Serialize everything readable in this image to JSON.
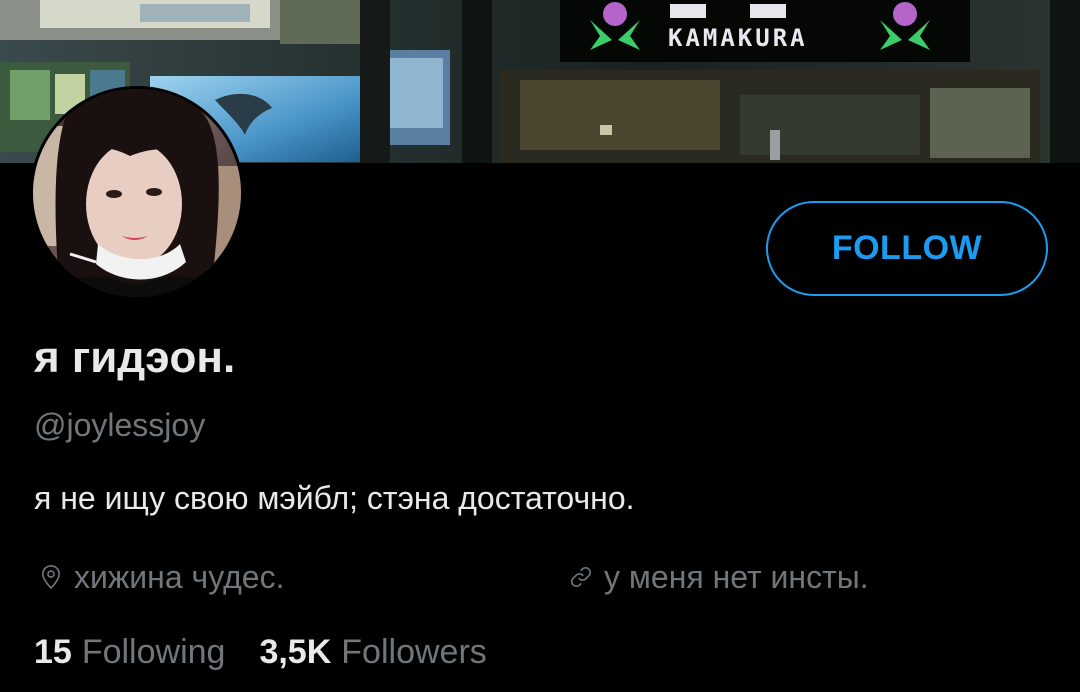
{
  "colors": {
    "background": "#000000",
    "accent": "#1d9bf0",
    "text_primary": "#e7e9ea",
    "text_secondary": "#71767b",
    "sign_green": "#3dcc6a"
  },
  "banner": {
    "sign_text": "KAMAKURA"
  },
  "profile": {
    "follow_label": "FOLLOW",
    "display_name": "я гидэон.",
    "handle": "@joylessjoy",
    "bio": "я не ищу свою мэйбл; стэна достаточно.",
    "location": {
      "icon": "location-pin-icon",
      "text": "хижина чудес."
    },
    "website": {
      "icon": "link-icon",
      "text": "у меня нет инсты."
    }
  },
  "stats": {
    "following_count": "15",
    "following_label": "Following",
    "followers_count": "3,5K",
    "followers_label": "Followers"
  }
}
